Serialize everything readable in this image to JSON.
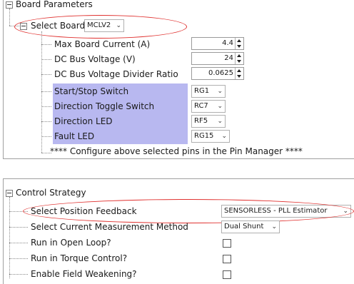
{
  "board_parameters": {
    "title": "Board Parameters",
    "select_board": {
      "label": "Select Board",
      "value": "MCLV2"
    },
    "fields": [
      {
        "label": "Max Board Current (A)",
        "value": "4.4"
      },
      {
        "label": "DC Bus Voltage (V)",
        "value": "24"
      },
      {
        "label": "DC Bus Voltage Divider Ratio",
        "value": "0.0625"
      }
    ],
    "pins": [
      {
        "label": "Start/Stop Switch",
        "value": "RG1"
      },
      {
        "label": "Direction Toggle Switch",
        "value": "RC7"
      },
      {
        "label": "Direction LED",
        "value": "RF5"
      },
      {
        "label": "Fault LED",
        "value": "RG15"
      }
    ],
    "note": "**** Configure above selected pins in the Pin Manager ****"
  },
  "control_strategy": {
    "title": "Control Strategy",
    "position_feedback": {
      "label": "Select Position Feedback",
      "value": "SENSORLESS - PLL Estimator"
    },
    "current_measurement": {
      "label": "Select Current Measurement Method",
      "value": "Dual Shunt"
    },
    "options": [
      {
        "label": "Run in Open Loop?",
        "checked": false
      },
      {
        "label": "Run in Torque Control?",
        "checked": false
      },
      {
        "label": "Enable Field Weakening?",
        "checked": false
      }
    ]
  },
  "highlight_color": "#e0312f",
  "pin_row_color": "#b8b8f0"
}
